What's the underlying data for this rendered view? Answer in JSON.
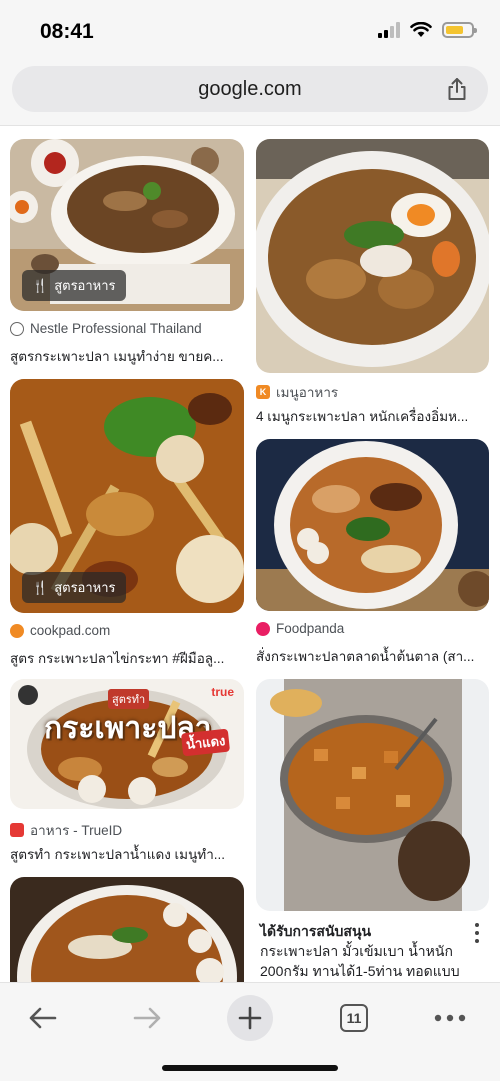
{
  "status_bar": {
    "time": "08:41"
  },
  "browser": {
    "url": "google.com",
    "tab_count": "11"
  },
  "results": {
    "card1": {
      "badge": "สูตรอาหาร",
      "source": "Nestle Professional Thailand",
      "title": "สูตรกระเพาะปลา เมนูทำง่าย ขายค..."
    },
    "card2": {
      "source": "เมนูอาหาร",
      "title": "4 เมนูกระเพาะปลา หนักเครื่องอิ่มห..."
    },
    "card3": {
      "badge": "สูตรอาหาร",
      "source": "cookpad.com",
      "title": "สูตร กระเพาะปลาไข่กระทา #ฝีมือลู..."
    },
    "card4": {
      "source": "Foodpanda",
      "title": "สั่งกระเพาะปลาตลาดน้ำต้นตาล (สา..."
    },
    "card5": {
      "overlay_text": "กระเพาะปลา",
      "overlay_small": "สูตรทำ",
      "overlay_red": "น้ำแดง",
      "brand_tag": "true",
      "source": "อาหาร - TrueID",
      "title": "สูตรทำ กระเพาะปลาน้ำแดง เมนูทำ..."
    },
    "card6": {
      "sponsored_label": "ได้รับการสนับสนุน",
      "description": "กระเพาะปลา มั้วเข้มเบา น้ำหนัก 200กรัม ทานได้1-5ท่าน ทอดแบบ"
    }
  },
  "icons": {
    "share": "share-icon",
    "back": "back-arrow-icon",
    "forward": "forward-arrow-icon",
    "new_tab": "plus-icon",
    "tabs": "tabs-icon",
    "more": "more-dots-icon"
  },
  "colors": {
    "accent_battery": "#f4c430",
    "truid_red": "#e53935",
    "cookpad_orange": "#f08a24",
    "foodpanda_pink": "#e91e63"
  }
}
